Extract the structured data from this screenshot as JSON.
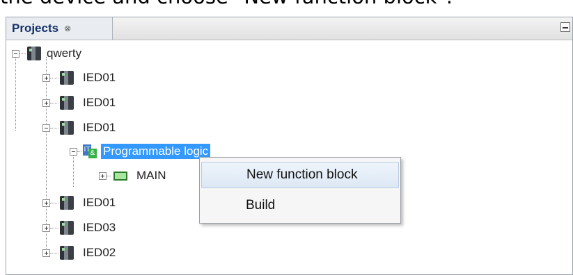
{
  "caption": "the device and choose \"New function block\".",
  "panel": {
    "tab_label": "Projects",
    "tab_close": "⊗"
  },
  "tree": {
    "root": "qwerty",
    "ied_rows": [
      "IED01",
      "IED01",
      "IED01",
      "IED01",
      "IED03",
      "IED02"
    ],
    "programmable": "Programmable logic",
    "main": "MAIN",
    "prog_icon_a": "IT",
    "prog_icon_b": "&"
  },
  "context_menu": {
    "items": [
      "New function block",
      "Build"
    ]
  }
}
